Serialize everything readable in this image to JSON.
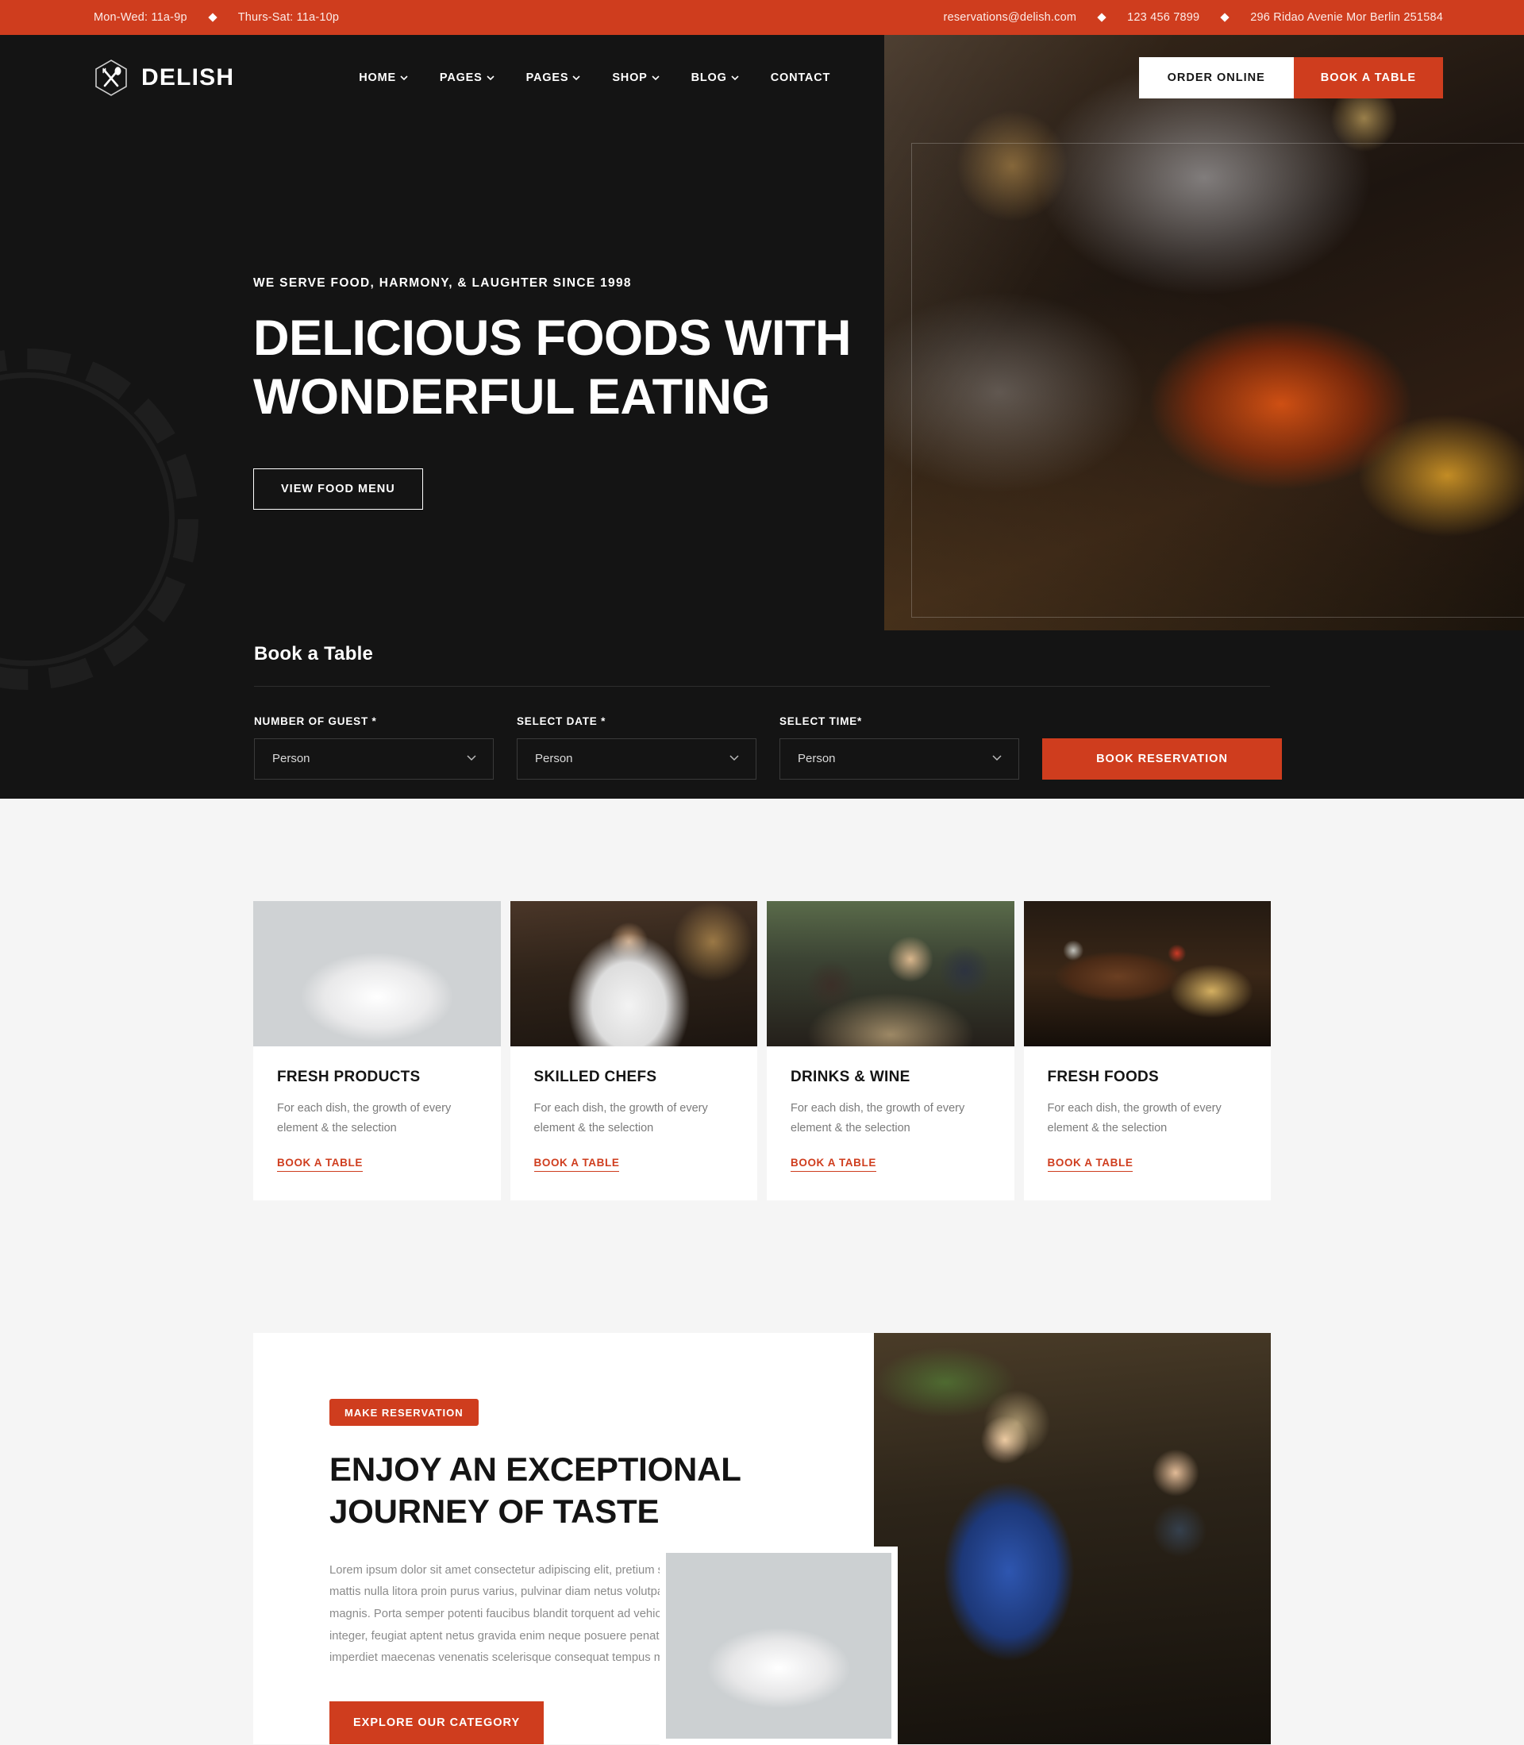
{
  "topbar": {
    "hours": [
      "Mon-Wed: 11a-9p",
      "Thurs-Sat: 11a-10p"
    ],
    "email": "reservations@delish.com",
    "phone": "123 456 7899",
    "address": "296 Ridao Avenie Mor Berlin 251584"
  },
  "brand": {
    "name": "DELISH",
    "logo_icon": "fork-spoon-hexagon-icon"
  },
  "nav": {
    "items": [
      {
        "label": "HOME",
        "has_dropdown": true
      },
      {
        "label": "PAGES",
        "has_dropdown": true
      },
      {
        "label": "PAGES",
        "has_dropdown": true
      },
      {
        "label": "SHOP",
        "has_dropdown": true
      },
      {
        "label": "BLOG",
        "has_dropdown": true
      },
      {
        "label": "CONTACT",
        "has_dropdown": false
      }
    ],
    "order_online": "ORDER ONLINE",
    "book_a_table": "BOOK A TABLE"
  },
  "hero": {
    "eyebrow": "WE SERVE FOOD, HARMONY, & LAUGHTER SINCE 1998",
    "title_line1": "DELICIOUS FOODS WITH",
    "title_line2": "WONDERFUL EATING",
    "cta": "VIEW FOOD MENU"
  },
  "booking": {
    "title": "Book a Table",
    "fields": [
      {
        "label": "NUMBER OF GUEST *",
        "value": "Person"
      },
      {
        "label": "SELECT DATE *",
        "value": "Person"
      },
      {
        "label": "SELECT TIME*",
        "value": "Person"
      }
    ],
    "submit": "BOOK RESERVATION"
  },
  "features": [
    {
      "title": "FRESH PRODUCTS",
      "text": "For each dish, the growth of every element & the selection",
      "link": "BOOK A TABLE"
    },
    {
      "title": "SKILLED CHEFS",
      "text": "For each dish, the growth of every element & the selection",
      "link": "BOOK A TABLE"
    },
    {
      "title": "DRINKS & WINE",
      "text": "For each dish, the growth of every element & the selection",
      "link": "BOOK A TABLE"
    },
    {
      "title": "FRESH FOODS",
      "text": "For each dish, the growth of every element & the selection",
      "link": "BOOK A TABLE"
    }
  ],
  "about": {
    "badge": "MAKE RESERVATION",
    "title_line1": "ENJOY AN EXCEPTIONAL",
    "title_line2": "JOURNEY OF TASTE",
    "text": "Lorem ipsum dolor sit amet consectetur adipiscing elit, pretium sapien mattis nulla litora proin purus varius, pulvinar diam netus volutpat morbi magnis. Porta semper potenti faucibus blandit torquent ad vehicula sociis integer, feugiat aptent netus gravida enim neque posuere penatibus, sed imperdiet maecenas venenatis scelerisque consequat tempus mauris.",
    "cta": "EXPLORE OUR CATEGORY"
  },
  "colors": {
    "accent": "#cf3d1e",
    "dark": "#141414",
    "page_bg": "#f5f5f5",
    "muted_text": "#8b8b8b"
  }
}
